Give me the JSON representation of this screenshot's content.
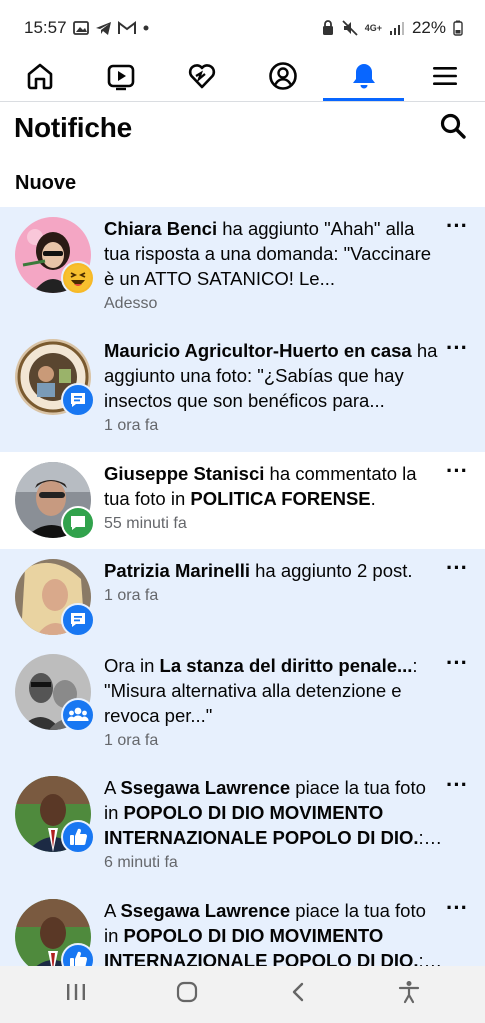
{
  "status_bar": {
    "time": "15:57",
    "network": "4G+",
    "battery": "22%",
    "icons": [
      "gallery-icon",
      "telegram-icon",
      "gmail-icon",
      "dot-icon"
    ],
    "right_icons": [
      "lock-icon",
      "mute-icon",
      "signal-icon",
      "battery-icon"
    ]
  },
  "nav": {
    "tabs": [
      {
        "icon": "home-icon",
        "active": false
      },
      {
        "icon": "video-icon",
        "active": false
      },
      {
        "icon": "dating-heart-icon",
        "active": false
      },
      {
        "icon": "profile-icon",
        "active": false
      },
      {
        "icon": "bell-icon",
        "active": true
      },
      {
        "icon": "menu-icon",
        "active": false
      }
    ]
  },
  "header": {
    "title": "Notifiche"
  },
  "section": {
    "title": "Nuove"
  },
  "notifications": [
    {
      "text_before": "",
      "bold1": "Chiara Benci",
      "text_middle": " ha aggiunto \"Ahah\" alla tua risposta a una domanda: \"Vaccinare è un ATTO SATANICO! Le...",
      "bold2": "",
      "text_after": "",
      "time": "Adesso",
      "badge": "haha-reaction-icon",
      "unread": true
    },
    {
      "text_before": "",
      "bold1": "Mauricio Agricultor-Huerto en casa",
      "text_middle": " ha aggiunto una foto: \"¿Sabías que hay insectos que son benéficos para...",
      "bold2": "",
      "text_after": "",
      "time": "1 ora fa",
      "badge": "group-post-icon",
      "unread": true
    },
    {
      "text_before": "",
      "bold1": "Giuseppe Stanisci",
      "text_middle": " ha commentato la tua foto in ",
      "bold2": "POLITICA FORENSE",
      "text_after": ".",
      "time": "55 minuti fa",
      "badge": "comment-icon",
      "unread": false
    },
    {
      "text_before": "",
      "bold1": "Patrizia Marinelli",
      "text_middle": " ha aggiunto 2 post.",
      "bold2": "",
      "text_after": "",
      "time": "1 ora fa",
      "badge": "group-post-icon",
      "unread": true
    },
    {
      "text_before": "Ora in ",
      "bold1": "La stanza del diritto penale...",
      "text_middle": ": \"Misura alternativa alla detenzione e revoca per...\"",
      "bold2": "",
      "text_after": "",
      "time": "1 ora fa",
      "badge": "groups-icon",
      "unread": true
    },
    {
      "text_before": "A ",
      "bold1": "Ssegawa Lawrence",
      "text_middle": " piace la tua foto in ",
      "bold2": "POPOLO DI DIO MOVIMENTO INTERNAZIONALE POPOLO DI DIO.",
      "text_after": ": ...",
      "time": "6 minuti fa",
      "badge": "like-icon",
      "unread": true
    },
    {
      "text_before": "A ",
      "bold1": "Ssegawa Lawrence",
      "text_middle": " piace la tua foto in ",
      "bold2": "POPOLO DI DIO MOVIMENTO INTERNAZIONALE POPOLO DI DIO.",
      "text_after": ": ...",
      "time": "",
      "badge": "like-icon",
      "unread": true
    }
  ],
  "bottom_nav": [
    "recent-apps-icon",
    "home-button-icon",
    "back-icon",
    "accessibility-icon"
  ],
  "colors": {
    "accent": "#0866ff",
    "unread_bg": "#e7f0fd",
    "like_badge": "#1877f2",
    "comment_badge": "#31a24c"
  }
}
